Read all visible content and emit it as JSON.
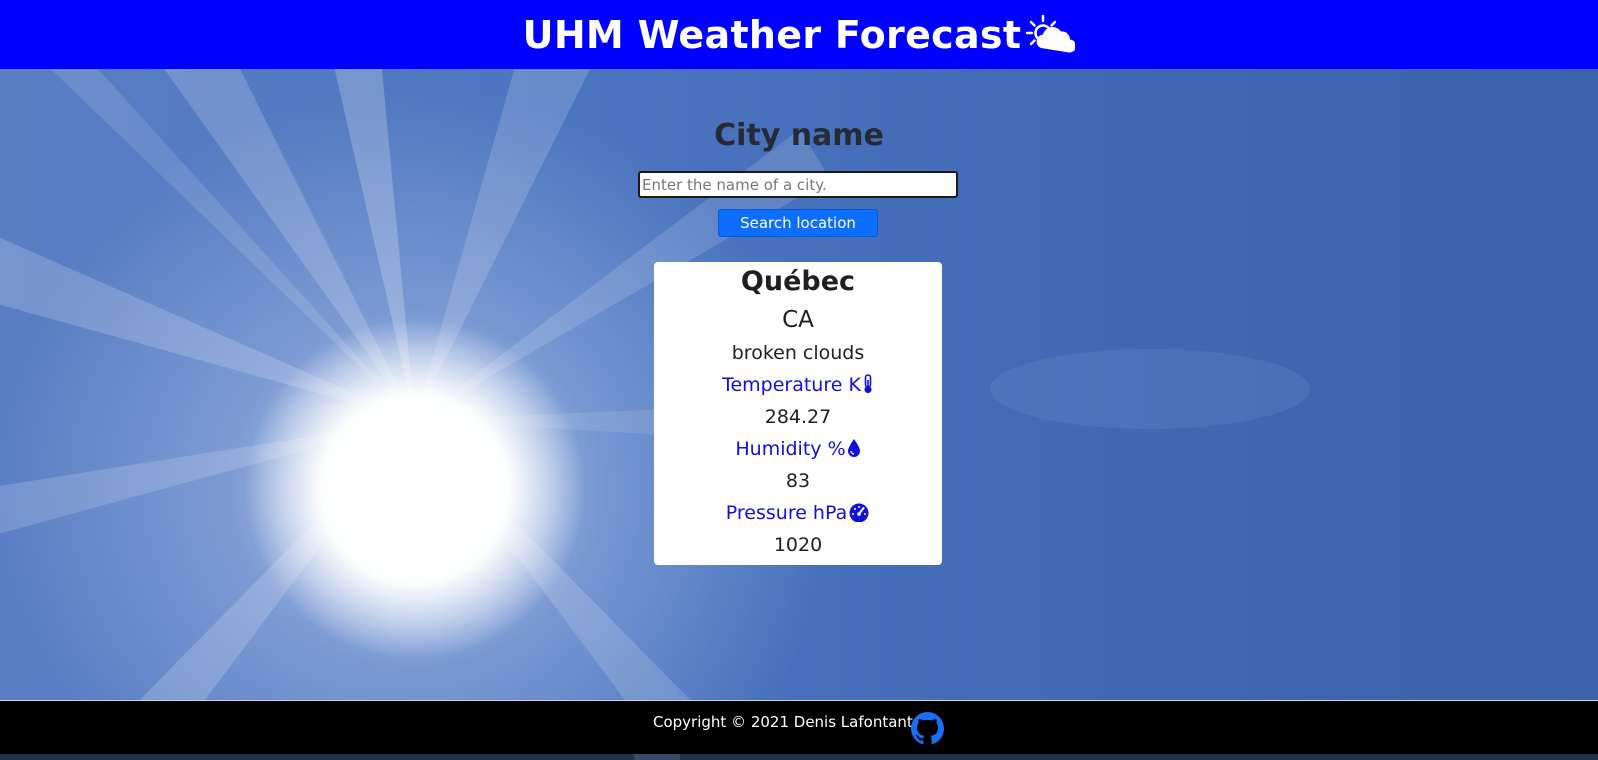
{
  "header": {
    "title": "UHM Weather Forecast",
    "icon": "sun-behind-cloud-icon"
  },
  "search": {
    "heading": "City name",
    "placeholder": "Enter the name of a city.",
    "value": "",
    "button_label": "Search location"
  },
  "weather": {
    "city": "Québec",
    "country": "CA",
    "description": "broken clouds",
    "temperature_label": "Temperature K",
    "temperature_icon": "thermometer-icon",
    "temperature_value": "284.27",
    "humidity_label": "Humidity %",
    "humidity_icon": "droplet-icon",
    "humidity_value": "83",
    "pressure_label": "Pressure hPa",
    "pressure_icon": "speedometer-icon",
    "pressure_value": "1020"
  },
  "footer": {
    "copyright": "Copyright © 2021 Denis Lafontant",
    "github_icon": "github-icon"
  },
  "colors": {
    "header_bg": "#0000ff",
    "button": "#0d6efd",
    "label": "#1010d8",
    "footer_bg": "#000000"
  }
}
